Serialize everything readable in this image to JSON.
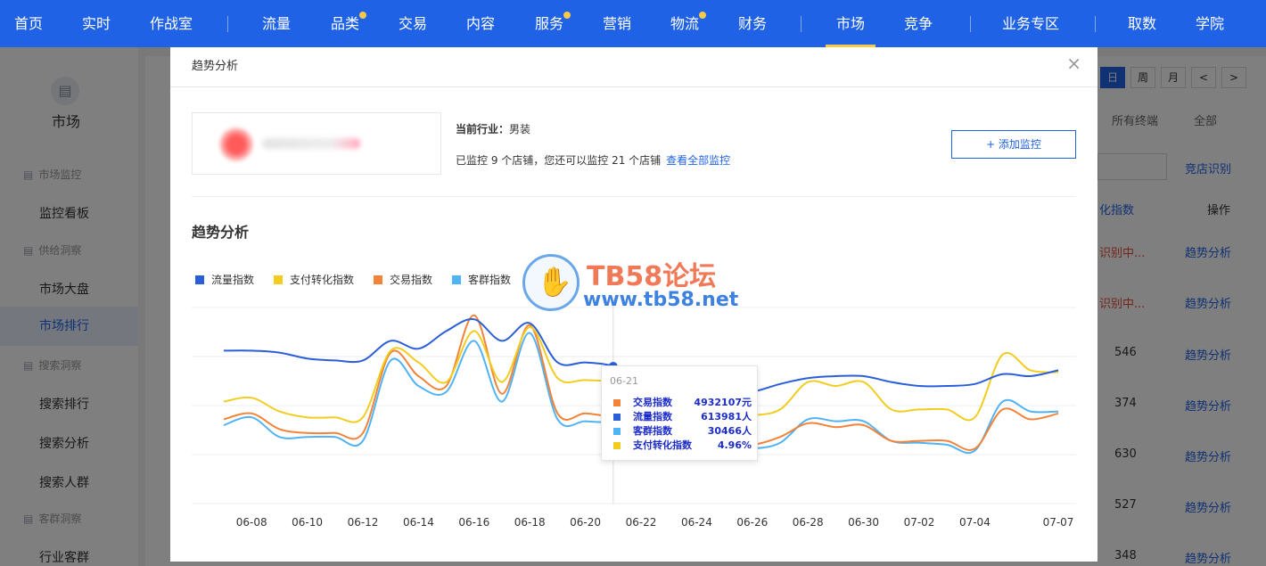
{
  "topnav": {
    "items": [
      {
        "label": "首页",
        "dot": false
      },
      {
        "label": "实时",
        "dot": false
      },
      {
        "label": "作战室",
        "dot": false
      },
      {
        "label": "流量",
        "dot": false
      },
      {
        "label": "品类",
        "dot": true
      },
      {
        "label": "交易",
        "dot": false
      },
      {
        "label": "内容",
        "dot": false
      },
      {
        "label": "服务",
        "dot": true
      },
      {
        "label": "营销",
        "dot": false
      },
      {
        "label": "物流",
        "dot": true
      },
      {
        "label": "财务",
        "dot": false
      },
      {
        "label": "市场",
        "dot": false,
        "active": true
      },
      {
        "label": "竞争",
        "dot": false
      },
      {
        "label": "业务专区",
        "dot": false
      },
      {
        "label": "取数",
        "dot": false
      },
      {
        "label": "学院",
        "dot": false
      }
    ]
  },
  "sidebar": {
    "title": "市场",
    "groups": [
      "市场监控",
      "供给洞察",
      "搜索洞察",
      "客群洞察"
    ],
    "items": [
      "监控看板",
      "市场大盘",
      "市场排行",
      "搜索排行",
      "搜索分析",
      "搜索人群",
      "行业客群"
    ]
  },
  "background": {
    "period_buttons": [
      "日",
      "周",
      "月",
      "<",
      ">"
    ],
    "filters": [
      "所有终端",
      "全部"
    ],
    "link_identify": "竞店识别",
    "col_conv": "化指数",
    "col_action": "操作",
    "row_action": "趋势分析",
    "identifying": "识别中...",
    "row_values": [
      "546",
      "374",
      "630",
      "527",
      "348"
    ]
  },
  "modal": {
    "title": "趋势分析",
    "close": "×",
    "industry_label": "当前行业：",
    "industry_value": "男装",
    "monitor_text": "已监控 9 个店铺，您还可以监控 21 个店铺",
    "monitor_link": "查看全部监控",
    "add_button": "+ 添加监控",
    "section_title": "趋势分析"
  },
  "watermark": {
    "line1": "TB58论坛",
    "line2": "www.tb58.net"
  },
  "chart_data": {
    "type": "line",
    "x": [
      "06-07",
      "06-08",
      "06-09",
      "06-10",
      "06-11",
      "06-12",
      "06-13",
      "06-14",
      "06-15",
      "06-16",
      "06-17",
      "06-18",
      "06-19",
      "06-20",
      "06-21",
      "06-22",
      "06-23",
      "06-24",
      "06-25",
      "06-26",
      "06-27",
      "06-28",
      "06-29",
      "06-30",
      "07-01",
      "07-02",
      "07-03",
      "07-04",
      "07-05",
      "07-06",
      "07-07"
    ],
    "x_tick_labels": [
      "06-08",
      "06-10",
      "06-12",
      "06-14",
      "06-16",
      "06-18",
      "06-20",
      "06-22",
      "06-24",
      "06-26",
      "06-28",
      "06-30",
      "07-02",
      "07-04",
      "07-07"
    ],
    "legend_position": "top-left",
    "grid": true,
    "ylim": [
      0,
      100
    ],
    "series": [
      {
        "name": "流量指数",
        "color": "#2b5fd9",
        "values": [
          78,
          78,
          77,
          74,
          73,
          73,
          83,
          79,
          88,
          94,
          83,
          92,
          72,
          72,
          70,
          63,
          60,
          58,
          56,
          57,
          61,
          64,
          65,
          65,
          62,
          60,
          60,
          61,
          66,
          65,
          68
        ]
      },
      {
        "name": "支付转化指数",
        "color": "#f2cd1f",
        "values": [
          52,
          54,
          47,
          44,
          44,
          44,
          78,
          72,
          62,
          88,
          62,
          90,
          64,
          63,
          62,
          57,
          52,
          47,
          44,
          45,
          48,
          62,
          60,
          62,
          48,
          48,
          48,
          44,
          76,
          68,
          67
        ]
      },
      {
        "name": "交易指数",
        "color": "#f28339",
        "values": [
          43,
          46,
          38,
          36,
          36,
          36,
          77,
          65,
          60,
          96,
          56,
          91,
          46,
          46,
          44,
          41,
          37,
          33,
          31,
          30,
          34,
          41,
          39,
          40,
          32,
          32,
          32,
          28,
          48,
          43,
          46
        ]
      },
      {
        "name": "客群指数",
        "color": "#4fb3f5",
        "values": [
          40,
          44,
          34,
          34,
          34,
          32,
          73,
          60,
          57,
          83,
          52,
          87,
          43,
          42,
          41,
          39,
          34,
          31,
          28,
          28,
          31,
          43,
          42,
          42,
          32,
          31,
          30,
          27,
          52,
          47,
          47
        ]
      }
    ],
    "tooltip": {
      "date": "06-21",
      "rows": [
        {
          "name": "交易指数",
          "value": "4932107元",
          "color": "#f28339"
        },
        {
          "name": "流量指数",
          "value": "613981人",
          "color": "#2b5fd9"
        },
        {
          "name": "客群指数",
          "value": "30466人",
          "color": "#4fb3f5"
        },
        {
          "name": "支付转化指数",
          "value": "4.96%",
          "color": "#f2cd1f"
        }
      ]
    }
  }
}
